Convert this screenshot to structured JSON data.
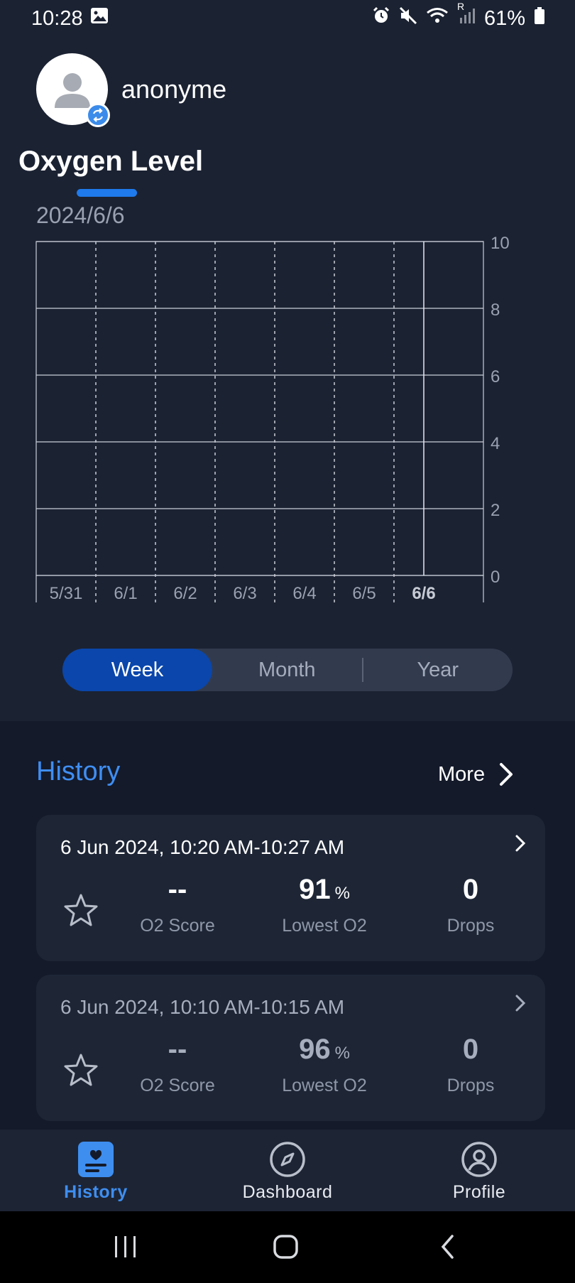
{
  "status_bar": {
    "time": "10:28",
    "battery": "61%",
    "signal_letter": "R",
    "icons": [
      "gallery-icon",
      "alarm-icon",
      "mute-icon",
      "wifi-icon",
      "signal-icon",
      "battery-icon"
    ]
  },
  "user": {
    "name": "anonyme"
  },
  "page": {
    "title": "Oxygen Level",
    "selected_date": "2024/6/6"
  },
  "colors": {
    "accent": "#1f7aec",
    "history_title": "#3f8ef2",
    "segment_active": "#0a46ab",
    "background": "#1b2232",
    "lower_background": "#141a2a"
  },
  "chart_data": {
    "type": "line",
    "categories": [
      "5/31",
      "6/1",
      "6/2",
      "6/3",
      "6/4",
      "6/5",
      "6/6"
    ],
    "highlighted_category": "6/6",
    "y_ticks": [
      "10",
      "8",
      "6",
      "4",
      "2",
      "0"
    ],
    "ylim": [
      0,
      10
    ],
    "series": [],
    "grid": true,
    "y_axis_position": "right"
  },
  "range_selector": {
    "options": [
      "Week",
      "Month",
      "Year"
    ],
    "selected": "Week"
  },
  "history": {
    "title": "History",
    "more_label": "More",
    "records": [
      {
        "datetime": "6 Jun 2024, 10:20 AM-10:27 AM",
        "o2_score": "--",
        "o2_score_label": "O2 Score",
        "lowest_o2": "91",
        "lowest_o2_unit": "%",
        "lowest_o2_label": "Lowest O2",
        "drops": "0",
        "drops_label": "Drops"
      },
      {
        "datetime": "6 Jun 2024, 10:10 AM-10:15 AM",
        "o2_score": "--",
        "o2_score_label": "O2 Score",
        "lowest_o2": "96",
        "lowest_o2_unit": "%",
        "lowest_o2_label": "Lowest O2",
        "drops": "0",
        "drops_label": "Drops"
      }
    ]
  },
  "bottom_nav": {
    "items": [
      {
        "label": "History",
        "icon": "history-icon",
        "active": true
      },
      {
        "label": "Dashboard",
        "icon": "compass-icon",
        "active": false
      },
      {
        "label": "Profile",
        "icon": "profile-icon",
        "active": false
      }
    ]
  }
}
